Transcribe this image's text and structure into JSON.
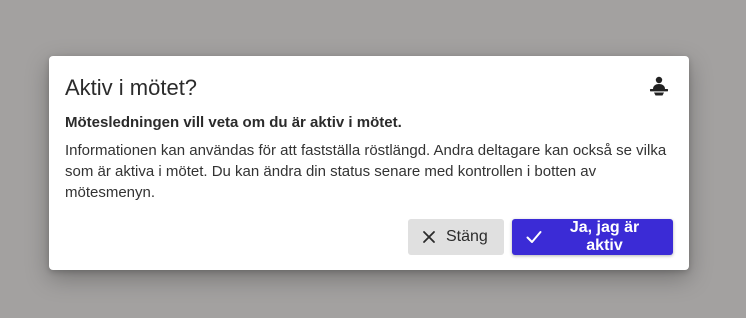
{
  "dialog": {
    "title": "Aktiv i mötet?",
    "lead": "Mötesledningen vill veta om du är aktiv i mötet.",
    "body": "Informationen kan användas för att fastställa röstlängd. Andra deltagare kan också se vilka som är aktiva i mötet. Du kan ändra din status senare med kontrollen i botten av mötesmenyn.",
    "icon": "person-at-desk-icon"
  },
  "actions": {
    "close_label": "Stäng",
    "close_icon": "close-icon",
    "confirm_label": "Ja, jag är aktiv",
    "confirm_icon": "check-icon"
  },
  "colors": {
    "backdrop": "#a3a1a0",
    "primary": "#3b2bd6",
    "secondary_button": "#e0e0e0"
  }
}
